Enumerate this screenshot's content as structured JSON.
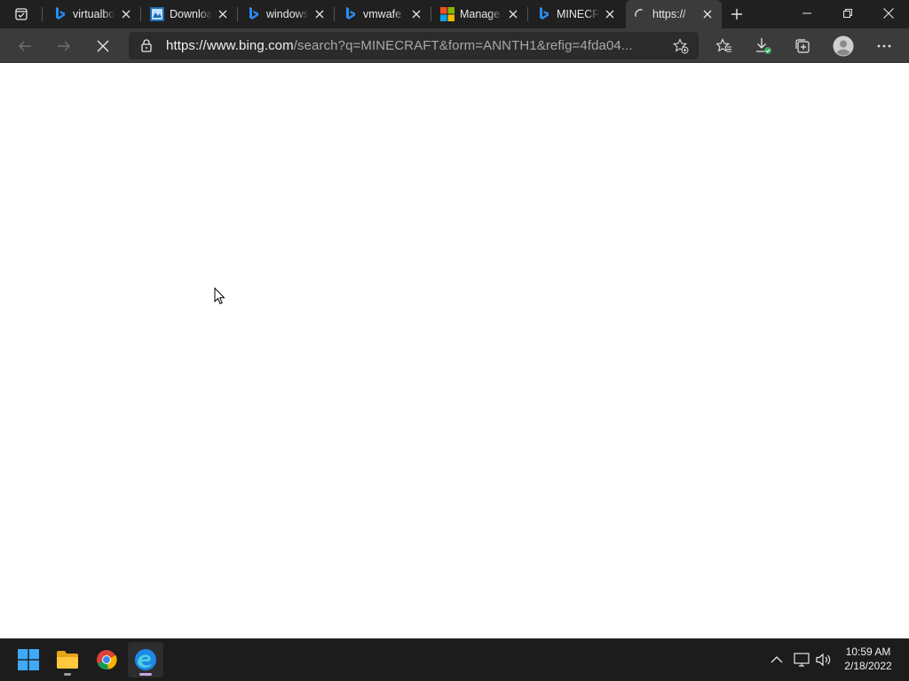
{
  "browser": {
    "tabs": [
      {
        "title": "virtualbox",
        "favicon": "bing-icon",
        "active": false
      },
      {
        "title": "Download",
        "favicon": "download-page-icon",
        "active": false
      },
      {
        "title": "windows",
        "favicon": "bing-icon",
        "active": false
      },
      {
        "title": "vmwafe",
        "favicon": "bing-icon",
        "active": false
      },
      {
        "title": "Manage",
        "favicon": "microsoft-logo-icon",
        "active": false
      },
      {
        "title": "MINECR",
        "favicon": "bing-icon",
        "active": false
      },
      {
        "title": "https://",
        "favicon": "loading-spinner-icon",
        "active": true
      }
    ],
    "address": {
      "url_host": "https://www.bing.com",
      "url_rest": "/search?q=MINECRAFT&form=ANNTH1&refig=4fda04..."
    },
    "toolbar_icons": [
      "back-icon",
      "forward-icon",
      "stop-loading-icon",
      "lock-icon",
      "add-favorite-icon",
      "favorites-icon",
      "downloads-icon",
      "collections-icon",
      "profile-icon",
      "more-icon"
    ]
  },
  "taskbar": {
    "apps": [
      "start-icon",
      "file-explorer-icon",
      "chrome-icon",
      "edge-icon"
    ],
    "tray_icons": [
      "show-hidden-icons-icon",
      "network-icon",
      "volume-icon"
    ],
    "time": "10:59 AM",
    "date": "2/18/2022"
  },
  "colors": {
    "titlebar": "#202020",
    "toolbar": "#3b3b3b",
    "taskbar": "#1c1c1c",
    "bing_blue": "#1a73e8",
    "edge_active_indicator": "#c6a7e6"
  }
}
